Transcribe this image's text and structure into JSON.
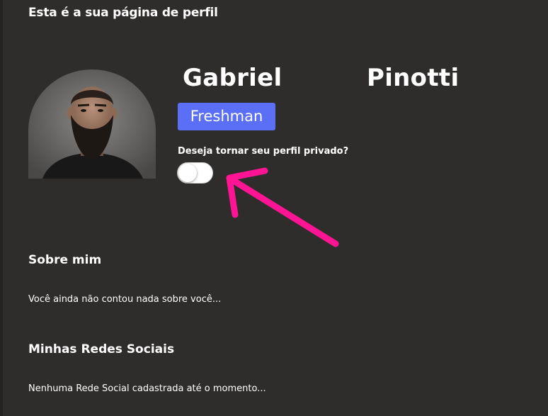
{
  "page": {
    "heading": "Esta é a sua página de perfil"
  },
  "profile": {
    "first_name": "Gabriel",
    "last_name": "Pinotti",
    "badge": "Freshman",
    "private_question": "Deseja tornar seu perfil privado?",
    "private_enabled": false
  },
  "about": {
    "title": "Sobre mim",
    "text": "Você ainda não contou nada sobre você..."
  },
  "social": {
    "title": "Minhas Redes Sociais",
    "text": "Nenhuma Rede Social cadastrada até o momento..."
  },
  "colors": {
    "background": "#2f2d2c",
    "badge": "#5a6ff5",
    "arrow": "#ff1493"
  },
  "icons": {
    "annotation_arrow": "pink-arrow-icon"
  }
}
